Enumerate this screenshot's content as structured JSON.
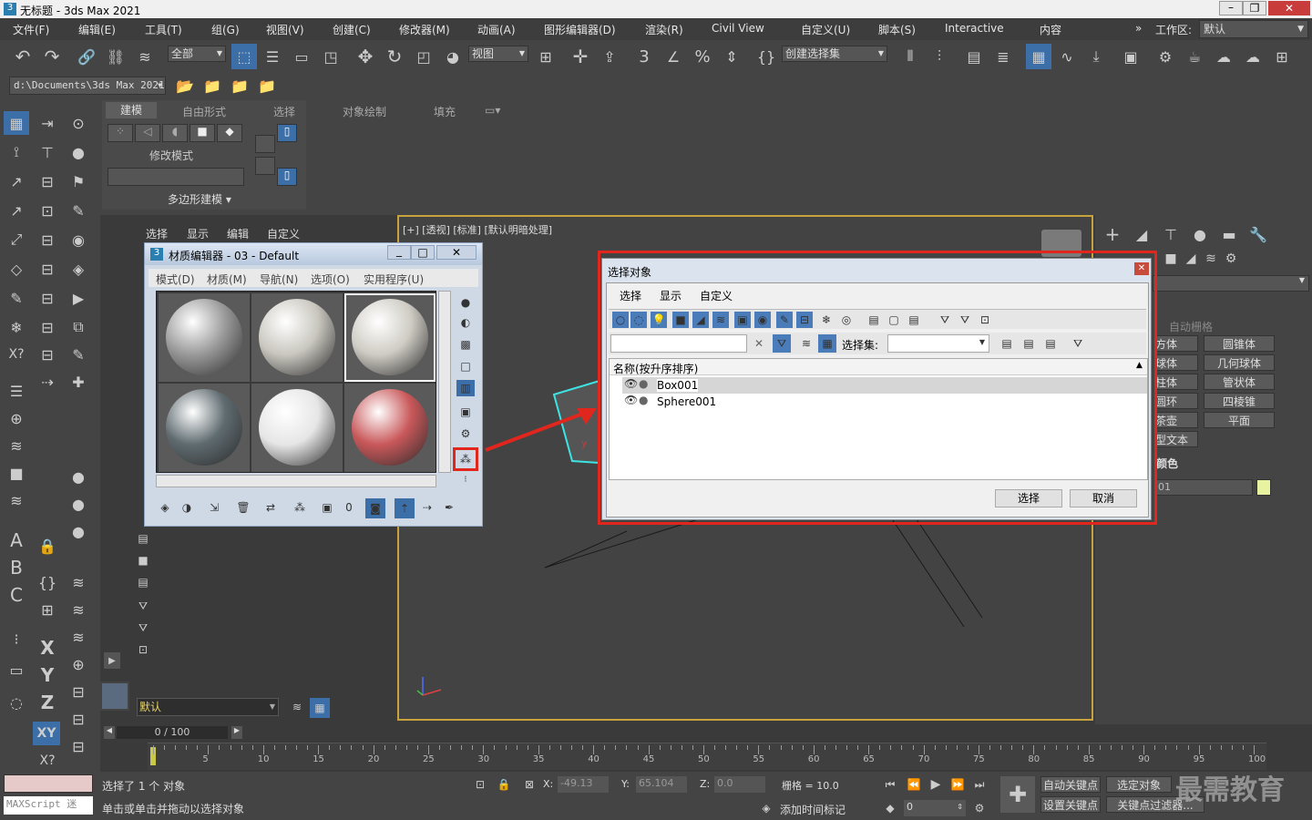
{
  "window": {
    "title": "无标题 - 3ds Max 2021"
  },
  "menu": [
    "文件(F)",
    "编辑(E)",
    "工具(T)",
    "组(G)",
    "视图(V)",
    "创建(C)",
    "修改器(M)",
    "动画(A)",
    "图形编辑器(D)",
    "渲染(R)",
    "Civil View",
    "自定义(U)",
    "脚本(S)",
    "Interactive",
    "内容"
  ],
  "workspace": {
    "label": "工作区:",
    "value": "默认"
  },
  "toolbar": {
    "filter": "全部",
    "ref_coord": "视图",
    "named_sel": "创建选择集",
    "path": "d:\\Documents\\3ds Max 2021"
  },
  "ribbon": {
    "tabs": [
      "建模",
      "自由形式",
      "选择",
      "对象绘制",
      "填充"
    ],
    "modify_mode": "修改模式",
    "poly_modeling": "多边形建模"
  },
  "scene_explorer": {
    "tabs": [
      "选择",
      "显示",
      "编辑",
      "自定义"
    ],
    "layer": "默认"
  },
  "mat_editor": {
    "title": "材质编辑器 - 03 - Default",
    "icon_num": "3",
    "menu": [
      "模式(D)",
      "材质(M)",
      "导航(N)",
      "选项(O)",
      "实用程序(U)"
    ],
    "spheres": [
      {
        "color": "#9a9a9a"
      },
      {
        "color": "#c9c7bf"
      },
      {
        "color": "#cfccc4"
      },
      {
        "color": "#5f6b70"
      },
      {
        "color": "#e6e6e6"
      },
      {
        "color": "#c9585a"
      }
    ]
  },
  "viewport": {
    "label": "[+] [透视] [标准] [默认明暗处理]"
  },
  "select_dialog": {
    "title": "选择对象",
    "menu": [
      "选择",
      "显示",
      "自定义"
    ],
    "selset_label": "选择集:",
    "col_header": "名称(按升序排序)",
    "items": [
      "Box001",
      "Sphere001"
    ],
    "select_btn": "选择",
    "cancel_btn": "取消"
  },
  "cmd_panel": {
    "autogrid": "自动栅格",
    "objects": [
      "方体",
      "圆锥体",
      "球体",
      "几何球体",
      "柱体",
      "管状体",
      "圆环",
      "四棱锥",
      "茶壶",
      "平面",
      "型文本"
    ],
    "name_color": "颜色",
    "name_value": "01"
  },
  "time": {
    "frame": "0 / 100",
    "ticks": [
      "5",
      "10",
      "15",
      "20",
      "25",
      "30",
      "35",
      "40",
      "45",
      "50",
      "55",
      "60",
      "65",
      "70",
      "75",
      "80",
      "85",
      "90",
      "95",
      "100"
    ]
  },
  "status": {
    "selected": "选择了 1 个 对象",
    "prompt": "单击或单击并拖动以选择对象",
    "maxscript": "MAXScript 迷",
    "x_label": "X:",
    "x": "-49.13",
    "y_label": "Y:",
    "y": "65.104",
    "z_label": "Z:",
    "z": "0.0",
    "grid": "栅格 = 10.0",
    "add_time_tag": "添加时间标记",
    "autokey": "自动关键点",
    "setkey": "设置关键点",
    "selected_obj": "选定对象",
    "key_filter": "关键点过滤器...",
    "frame_val": "0"
  },
  "watermark": "最需教育"
}
